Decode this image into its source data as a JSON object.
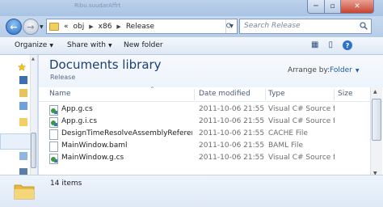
{
  "window": {
    "background_title": "Ribu.suudarAffrt",
    "minimize_glyph": "─",
    "maximize_glyph": "▫",
    "close_glyph": "✕"
  },
  "navigation": {
    "back_glyph": "←",
    "forward_glyph": "→",
    "history_glyph": "▼",
    "address": {
      "overflow": "«",
      "crumbs": [
        "obj",
        "x86",
        "Release"
      ],
      "separator": "▶",
      "dropdown": "▼"
    },
    "refresh_glyph": "⟳",
    "search_placeholder": "Search Release"
  },
  "toolbar": {
    "organize": "Organize",
    "share_with": "Share with",
    "new_folder": "New folder",
    "caret": "▼",
    "views_glyph": "▦",
    "preview_glyph": "▯",
    "help_glyph": "?"
  },
  "library": {
    "title": "Documents library",
    "subtitle": "Release",
    "arrange_by_label": "Arrange by:",
    "arrange_by_value": "Folder",
    "caret": "▼"
  },
  "columns": {
    "name": "Name",
    "date_modified": "Date modified",
    "type": "Type",
    "size": "Size",
    "sort_glyph": "^"
  },
  "files": [
    {
      "name": "App.g.cs",
      "date": "2011-10-06 21:55",
      "type": "Visual C# Source f...",
      "icon": "csharp-file-icon"
    },
    {
      "name": "App.g.i.cs",
      "date": "2011-10-06 21:55",
      "type": "Visual C# Source f...",
      "icon": "csharp-file-icon"
    },
    {
      "name": "DesignTimeResolveAssemblyReferencesI...",
      "date": "2011-10-06 21:55",
      "type": "CACHE File",
      "icon": "generic-file-icon"
    },
    {
      "name": "MainWindow.baml",
      "date": "2011-10-06 21:55",
      "type": "BAML File",
      "icon": "generic-file-icon"
    },
    {
      "name": "MainWindow.g.cs",
      "date": "2011-10-06 21:55",
      "type": "Visual C# Source f...",
      "icon": "csharp-file-icon"
    }
  ],
  "scroll": {
    "up": "▲",
    "down": "▼",
    "left": "◀",
    "right": "▶",
    "grip": "|||"
  },
  "details_pane": {
    "item_count": "14 items"
  }
}
